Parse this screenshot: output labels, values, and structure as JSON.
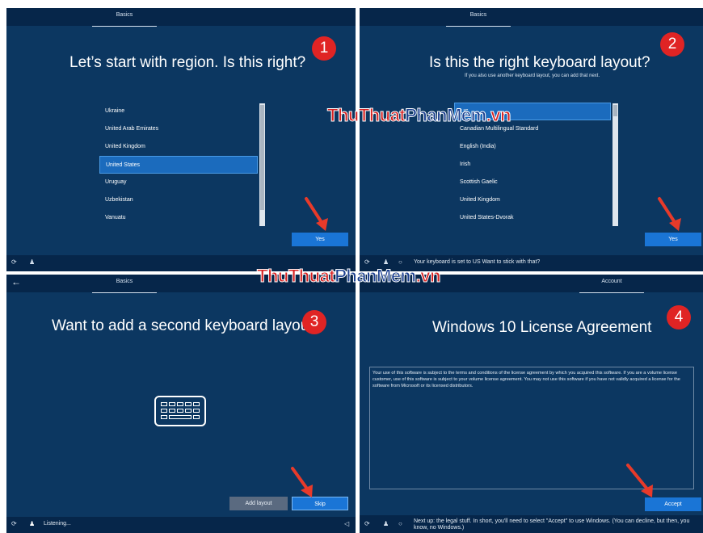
{
  "panel1": {
    "tab": "Basics",
    "heading": "Let’s start with region. Is this right?",
    "items": [
      "Ukraine",
      "United Arab Emirates",
      "United Kingdom",
      "United States",
      "Uruguay",
      "Uzbekistan",
      "Vanuatu"
    ],
    "selected": "United States",
    "button": "Yes",
    "badge": "1"
  },
  "panel2": {
    "tab": "Basics",
    "heading": "Is this the right keyboard layout?",
    "subheading": "If you also use another keyboard layout, you can add that next.",
    "items": [
      "US",
      "Canadian Multilingual Standard",
      "English (India)",
      "Irish",
      "Scottish Gaelic",
      "United Kingdom",
      "United States-Dvorak"
    ],
    "button": "Yes",
    "badge": "2",
    "status": "Your keyboard is set to US Want to stick with that?"
  },
  "panel3": {
    "tab": "Basics",
    "heading": "Want to add a second keyboard layou",
    "add_button": "Add layout",
    "skip_button": "Skip",
    "badge": "3",
    "status": "Listening..."
  },
  "panel4": {
    "tab": "Account",
    "heading": "Windows 10 License Agreement",
    "license": "Your use of this software is subject to the terms and conditions of the license agreement by which you acquired this software. If you are a volume license customer, use of this software is subject to your volume license agreement. You may not use this software if you have not validly acquired a license for the software from Microsoft or its licensed distributors.",
    "button": "Accept",
    "badge": "4",
    "status": "Next up: the legal stuff. In short, you'll need to select \"Accept\" to use Windows. (You can decline, but then, you know, no Windows.)"
  },
  "watermark": {
    "part1": "ThuThuat",
    "part2": "PhanMem",
    "part3": ".vn"
  },
  "colors": {
    "background": "#0c3761",
    "bar": "#06264a",
    "accent": "#1a75d6",
    "badge": "#e02424",
    "watermark_red": "#d62020",
    "watermark_blue": "#1a3f8f"
  }
}
